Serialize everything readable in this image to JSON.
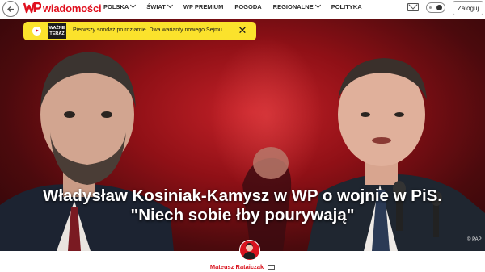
{
  "header": {
    "logo_text": "wiadomości",
    "nav": [
      {
        "label": "POLSKA",
        "dropdown": true
      },
      {
        "label": "ŚWIAT",
        "dropdown": true
      },
      {
        "label": "WP PREMIUM",
        "dropdown": false
      },
      {
        "label": "POGODA",
        "dropdown": false
      },
      {
        "label": "REGIONALNE",
        "dropdown": true
      },
      {
        "label": "POLITYKA",
        "dropdown": false
      }
    ],
    "login_label": "Zaloguj"
  },
  "alert": {
    "badge_line1": "WAŻNE",
    "badge_line2": "TERAZ",
    "text": "Pierwszy sondaż po rozłamie. Dwa warianty nowego Sejmu"
  },
  "article": {
    "headline_line1": "Władysław Kosiniak-Kamysz w WP o wojnie w PiS.",
    "headline_line2": "\"Niech sobie łby pourywają\"",
    "photo_credit": "© PAP",
    "author": "Mateusz Rataiczak"
  },
  "colors": {
    "brand_red": "#e0101e",
    "alert_yellow": "#fbe22c",
    "hero_red": "#c42128"
  }
}
